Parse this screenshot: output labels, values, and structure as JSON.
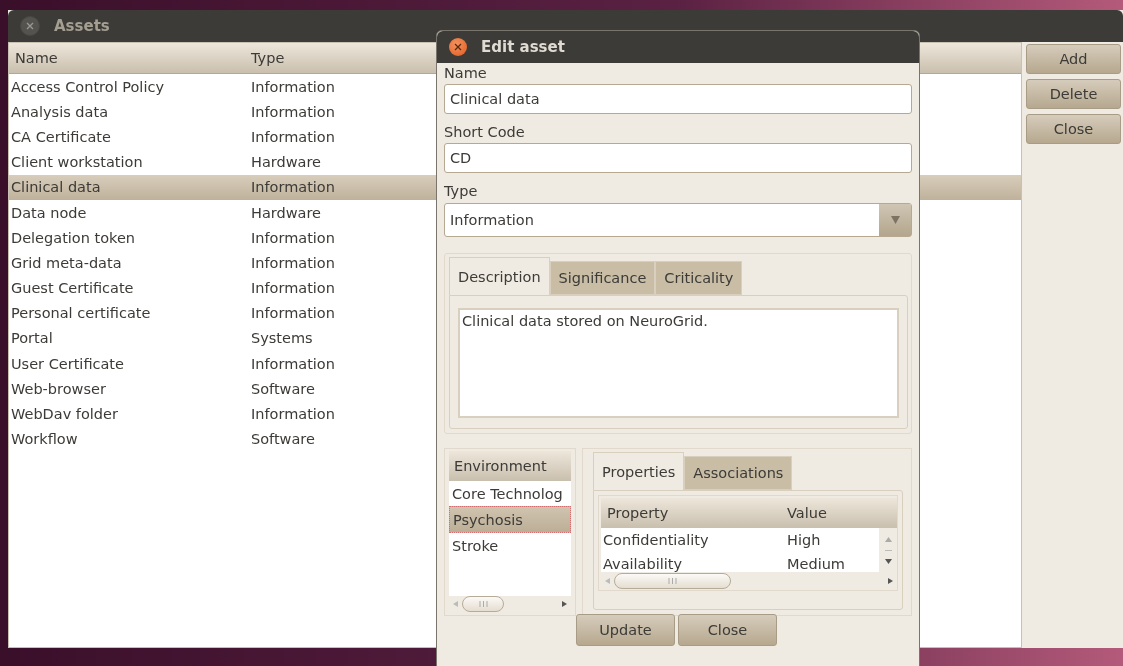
{
  "assets_window": {
    "title": "Assets",
    "columns": [
      "Name",
      "Type"
    ],
    "rows": [
      {
        "name": "Access Control Policy",
        "type": "Information",
        "selected": false
      },
      {
        "name": "Analysis data",
        "type": "Information",
        "selected": false
      },
      {
        "name": "CA Certificate",
        "type": "Information",
        "selected": false
      },
      {
        "name": "Client workstation",
        "type": "Hardware",
        "selected": false
      },
      {
        "name": "Clinical data",
        "type": "Information",
        "selected": true
      },
      {
        "name": "Data node",
        "type": "Hardware",
        "selected": false
      },
      {
        "name": "Delegation token",
        "type": "Information",
        "selected": false
      },
      {
        "name": "Grid meta-data",
        "type": "Information",
        "selected": false
      },
      {
        "name": "Guest Certificate",
        "type": "Information",
        "selected": false
      },
      {
        "name": "Personal certificate",
        "type": "Information",
        "selected": false
      },
      {
        "name": "Portal",
        "type": "Systems",
        "selected": false
      },
      {
        "name": "User Certificate",
        "type": "Information",
        "selected": false
      },
      {
        "name": "Web-browser",
        "type": "Software",
        "selected": false
      },
      {
        "name": "WebDav folder",
        "type": "Information",
        "selected": false
      },
      {
        "name": "Workflow",
        "type": "Software",
        "selected": false
      }
    ],
    "buttons": [
      "Add",
      "Delete",
      "Close"
    ]
  },
  "edit_dialog": {
    "title": "Edit asset",
    "name": {
      "label": "Name",
      "value": "Clinical data"
    },
    "short_code": {
      "label": "Short Code",
      "value": "CD"
    },
    "type": {
      "label": "Type",
      "value": "Information"
    },
    "tabs": [
      {
        "label": "Description",
        "selected": true
      },
      {
        "label": "Significance",
        "selected": false
      },
      {
        "label": "Criticality",
        "selected": false
      }
    ],
    "description": "Clinical data stored on NeuroGrid.",
    "environments": {
      "header": "Environment",
      "items": [
        {
          "label": "Core Technolog",
          "selected": false
        },
        {
          "label": "Psychosis",
          "selected": true
        },
        {
          "label": "Stroke",
          "selected": false
        }
      ]
    },
    "property_tabs": [
      {
        "label": "Properties",
        "selected": true
      },
      {
        "label": "Associations",
        "selected": false
      }
    ],
    "properties": {
      "columns": [
        "Property",
        "Value"
      ],
      "rows": [
        {
          "property": "Confidentiality",
          "value": "High"
        },
        {
          "property": "Availability",
          "value": "Medium"
        }
      ]
    },
    "buttons": [
      "Update",
      "Close"
    ]
  }
}
